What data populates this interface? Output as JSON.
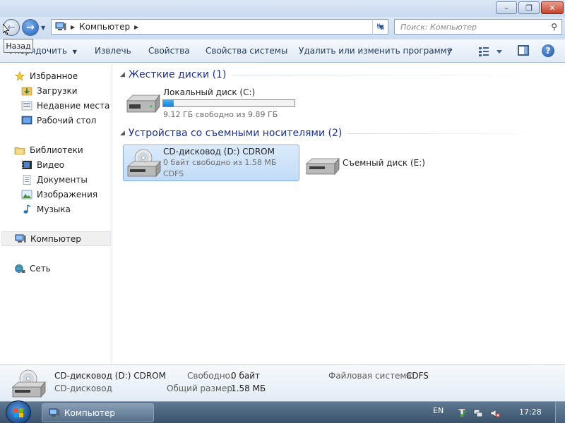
{
  "window": {
    "controls": {
      "minimize": "–",
      "maximize": "❐",
      "close": "✕"
    }
  },
  "nav": {
    "back_tooltip": "Назад",
    "address_path": [
      "Компьютер"
    ],
    "search_placeholder": "Поиск: Компьютер"
  },
  "toolbar": {
    "organize": "Упорядочить",
    "eject": "Извлечь",
    "properties": "Свойства",
    "system_properties": "Свойства системы",
    "uninstall": "Удалить или изменить программу",
    "more": "»",
    "help": "?"
  },
  "sidebar": {
    "favorites": {
      "label": "Избранное",
      "items": [
        {
          "label": "Загрузки",
          "icon": "downloads-folder-icon"
        },
        {
          "label": "Недавние места",
          "icon": "recent-places-icon"
        },
        {
          "label": "Рабочий стол",
          "icon": "desktop-icon"
        }
      ]
    },
    "libraries": {
      "label": "Библиотеки",
      "items": [
        {
          "label": "Видео",
          "icon": "video-library-icon"
        },
        {
          "label": "Документы",
          "icon": "documents-library-icon"
        },
        {
          "label": "Изображения",
          "icon": "pictures-library-icon"
        },
        {
          "label": "Музыка",
          "icon": "music-library-icon"
        }
      ]
    },
    "computer": "Компьютер",
    "network": "Сеть"
  },
  "content": {
    "hard_drives": {
      "title": "Жесткие диски (1)",
      "drives": [
        {
          "name": "Локальный диск (C:)",
          "free": "9.12 ГБ свободно из 9.89 ГБ",
          "used_fraction": 0.078
        }
      ]
    },
    "removable": {
      "title": "Устройства со съемными носителями (2)",
      "drives": [
        {
          "name": "CD-дисковод (D:) CDROM",
          "free": "0 байт свободно из 1.58 МБ",
          "fs": "CDFS",
          "selected": true
        },
        {
          "name": "Съемный диск (E:)"
        }
      ]
    }
  },
  "details": {
    "name": "CD-дисковод (D:) CDROM",
    "type": "CD-дисковод",
    "free_label": "Свободно:",
    "free_value": "0 байт",
    "total_label": "Общий размер:",
    "total_value": "1.58 МБ",
    "fs_label": "Файловая система:",
    "fs_value": "CDFS"
  },
  "taskbar": {
    "task_label": "Компьютер",
    "language": "EN",
    "clock": "17:28"
  },
  "colors": {
    "selection_bg": "#cce4fb",
    "group_title": "#1e3287",
    "toolbar_text": "#1e395b",
    "bar_fill": "#1a80cf"
  }
}
